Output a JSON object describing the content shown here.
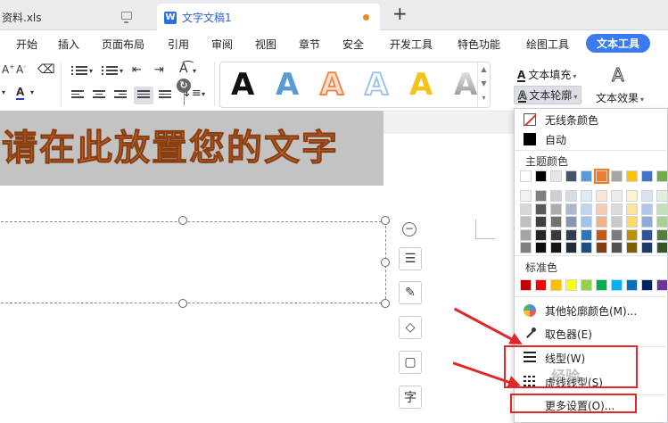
{
  "tabs": [
    {
      "label": "资料.xls"
    },
    {
      "label": "文字文稿1"
    }
  ],
  "menu": [
    "开始",
    "插入",
    "页面布局",
    "引用",
    "审阅",
    "视图",
    "章节",
    "安全",
    "开发工具",
    "特色功能",
    "绘图工具",
    "文本工具"
  ],
  "ribbon": {
    "text_fill_label": "文本填充",
    "text_outline_label": "文本轮廓",
    "text_effect_label": "文本效果",
    "wordart_glyph": "A",
    "wordart_styles": [
      {
        "color": "#111111"
      },
      {
        "color": "#5a9bd6"
      },
      {
        "color": "#f08a4b"
      },
      {
        "color": "#9fc4ea"
      },
      {
        "color": "#f5c318"
      },
      {
        "color": "#a9a9a9"
      }
    ]
  },
  "document": {
    "wordart_text": "请在此放置您的文字"
  },
  "dropdown": {
    "no_line_color": "无线条颜色",
    "auto": "自动",
    "theme_colors_label": "主题颜色",
    "standard_colors_label": "标准色",
    "more_outline_colors": "其他轮廓颜色(M)...",
    "eyedropper": "取色器(E)",
    "line_weight": "线型(W)",
    "dash_type": "虚线线型(S)",
    "more_settings": "更多设置(O)...",
    "theme_top_row": [
      "#ffffff",
      "#000000",
      "#e7e6e6",
      "#44546a",
      "#5b9bd5",
      "#ed7d31",
      "#a5a5a5",
      "#ffc000",
      "#4472c4",
      "#70ad47"
    ],
    "theme_shades": [
      [
        "#f2f2f2",
        "#7f7f7f",
        "#d0cece",
        "#d6dce4",
        "#deebf6",
        "#fbe5d5",
        "#ededed",
        "#fff2cc",
        "#dae3f3",
        "#e2efd9"
      ],
      [
        "#d8d8d8",
        "#595959",
        "#aeabab",
        "#adb9ca",
        "#bdd7ee",
        "#f7cbac",
        "#dbdbdb",
        "#fee599",
        "#b4c6e7",
        "#c5e0b3"
      ],
      [
        "#bfbfbf",
        "#3f3f3f",
        "#757070",
        "#8496b0",
        "#9dc3e6",
        "#f4b183",
        "#c9c9c9",
        "#ffd965",
        "#8eaadb",
        "#a8d08d"
      ],
      [
        "#a5a5a5",
        "#262626",
        "#3a3838",
        "#333f4f",
        "#2e75b5",
        "#c55a11",
        "#7b7b7b",
        "#bf9000",
        "#2f5496",
        "#538135"
      ],
      [
        "#7f7f7f",
        "#0c0c0c",
        "#171616",
        "#222a35",
        "#1e4e79",
        "#833c0b",
        "#525252",
        "#7f6000",
        "#1f3864",
        "#375623"
      ]
    ],
    "standard_row": [
      "#c00000",
      "#ff0000",
      "#ffc000",
      "#ffff00",
      "#92d050",
      "#00b050",
      "#00b0f0",
      "#0070c0",
      "#002060",
      "#7030a0"
    ]
  },
  "watermark": "经验"
}
